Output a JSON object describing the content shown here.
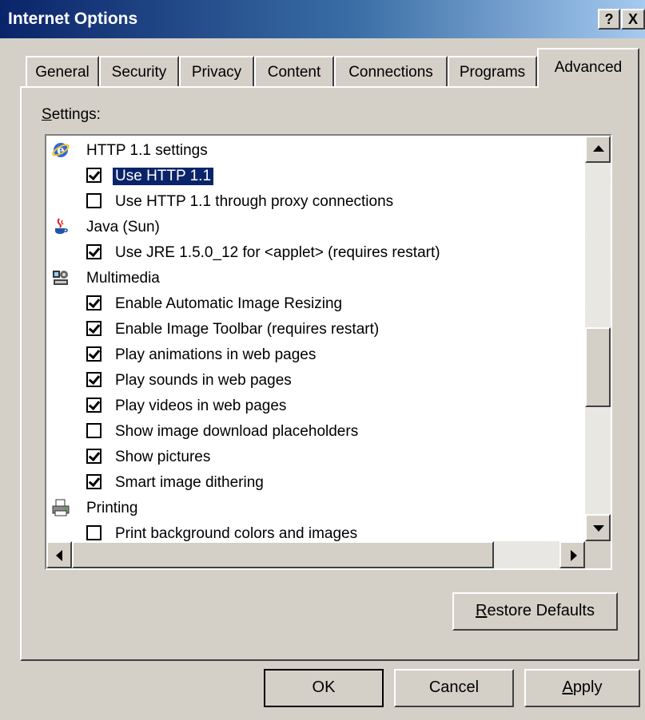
{
  "window": {
    "title": "Internet Options",
    "help_label": "?",
    "close_label": "X"
  },
  "tabs": [
    {
      "label": "General"
    },
    {
      "label": "Security"
    },
    {
      "label": "Privacy"
    },
    {
      "label": "Content"
    },
    {
      "label": "Connections"
    },
    {
      "label": "Programs"
    },
    {
      "label": "Advanced"
    }
  ],
  "settings": {
    "label_first": "S",
    "label_rest": "ettings:",
    "items": [
      {
        "kind": "category",
        "label": "HTTP 1.1 settings",
        "icon": "ie-icon"
      },
      {
        "kind": "check",
        "label": "Use HTTP 1.1",
        "checked": true,
        "selected": true
      },
      {
        "kind": "check",
        "label": "Use HTTP 1.1 through proxy connections",
        "checked": false
      },
      {
        "kind": "category",
        "label": "Java (Sun)",
        "icon": "java-icon"
      },
      {
        "kind": "check",
        "label": "Use JRE 1.5.0_12 for <applet> (requires restart)",
        "checked": true
      },
      {
        "kind": "category",
        "label": "Multimedia",
        "icon": "multimedia-icon"
      },
      {
        "kind": "check",
        "label": "Enable Automatic Image Resizing",
        "checked": true
      },
      {
        "kind": "check",
        "label": "Enable Image Toolbar (requires restart)",
        "checked": true
      },
      {
        "kind": "check",
        "label": "Play animations in web pages",
        "checked": true
      },
      {
        "kind": "check",
        "label": "Play sounds in web pages",
        "checked": true
      },
      {
        "kind": "check",
        "label": "Play videos in web pages",
        "checked": true
      },
      {
        "kind": "check",
        "label": "Show image download placeholders",
        "checked": false
      },
      {
        "kind": "check",
        "label": "Show pictures",
        "checked": true
      },
      {
        "kind": "check",
        "label": "Smart image dithering",
        "checked": true
      },
      {
        "kind": "category",
        "label": "Printing",
        "icon": "printer-icon"
      },
      {
        "kind": "check",
        "label": "Print background colors and images",
        "checked": false
      }
    ]
  },
  "buttons": {
    "restore_first": "R",
    "restore_rest": "estore Defaults",
    "ok": "OK",
    "cancel": "Cancel",
    "apply_first": "A",
    "apply_rest": "pply"
  }
}
